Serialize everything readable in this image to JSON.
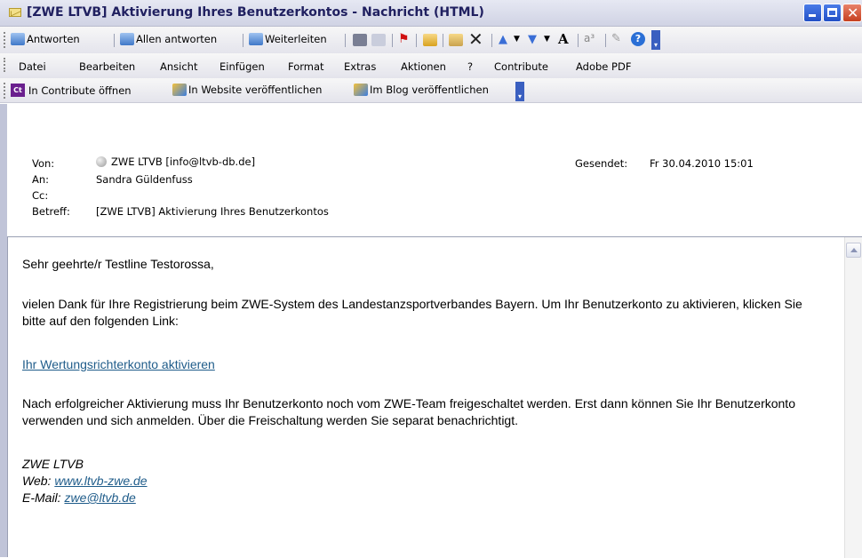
{
  "window": {
    "title": "[ZWE LTVB] Aktivierung Ihres Benutzerkontos - Nachricht (HTML)"
  },
  "toolbar1": {
    "reply": "Antworten",
    "reply_all": "Allen antworten",
    "forward": "Weiterleiten",
    "font_size_glyph": "A",
    "help_glyph": "?"
  },
  "menu": {
    "items": [
      "Datei",
      "Bearbeiten",
      "Ansicht",
      "Einfügen",
      "Format",
      "Extras",
      "Aktionen",
      "?",
      "Contribute",
      "Adobe PDF"
    ]
  },
  "toolbar3": {
    "contribute_open": "In Contribute öffnen",
    "publish_website": "In Website veröffentlichen",
    "publish_blog": "Im Blog veröffentlichen",
    "contribute_badge": "Ct"
  },
  "header": {
    "from_label": "Von:",
    "from_value": "ZWE LTVB [info@ltvb-db.de]",
    "to_label": "An:",
    "to_value": "Sandra Güldenfuss",
    "cc_label": "Cc:",
    "subject_label": "Betreff:",
    "subject_value": "[ZWE LTVB] Aktivierung Ihres Benutzerkontos",
    "sent_label": "Gesendet:",
    "sent_value": "Fr 30.04.2010 15:01"
  },
  "body": {
    "greeting": "Sehr geehrte/r Testline Testorossa,",
    "para1": "vielen Dank für Ihre Registrierung beim ZWE-System des Landestanzsportverbandes Bayern. Um Ihr Benutzerkonto zu aktivieren, klicken Sie bitte auf den folgenden Link:",
    "activation_link": "Ihr Wertungsrichterkonto aktivieren",
    "para2": "Nach erfolgreicher Aktivierung muss Ihr Benutzerkonto noch vom ZWE-Team freigeschaltet werden. Erst dann können Sie Ihr Benutzerkonto verwenden und sich anmelden. Über die Freischaltung werden Sie separat benachrichtigt.",
    "sig_name": "ZWE LTVB",
    "sig_web_label": "Web: ",
    "sig_web_link": "www.ltvb-zwe.de",
    "sig_mail_label": "E-Mail: ",
    "sig_mail_link": "zwe@ltvb.de"
  },
  "colors": {
    "link": "#1f5c8a",
    "titlebar_text": "#202060"
  }
}
